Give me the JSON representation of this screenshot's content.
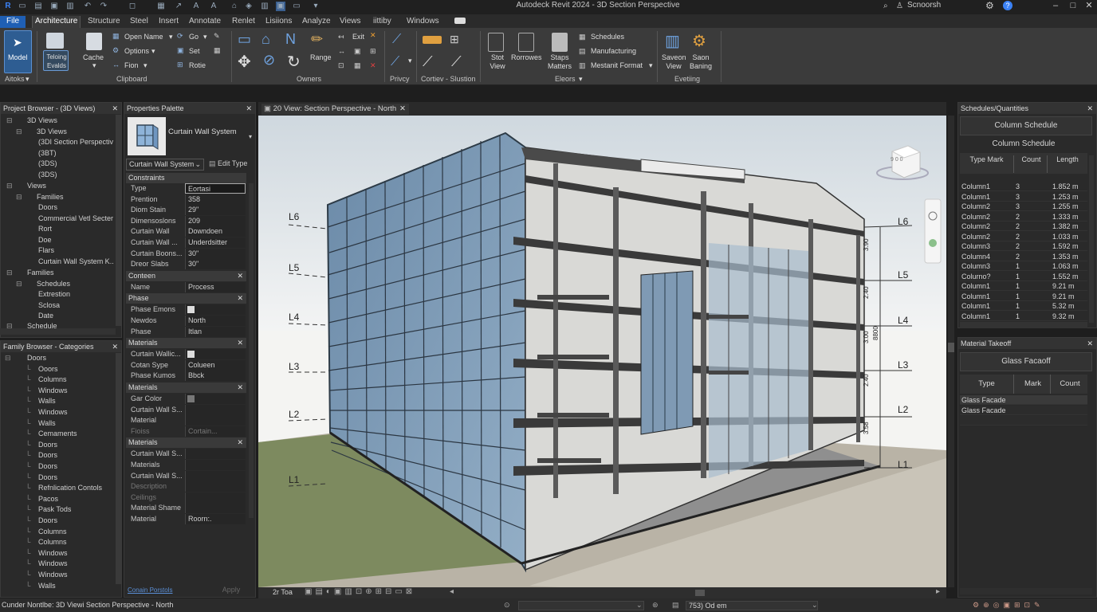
{
  "title_bar": {
    "title": "Autodeck Revit 2024 - 3D Section Perspective",
    "user": "Scnoorsh"
  },
  "tabs": [
    "File",
    "Architecture",
    "Structure",
    "Steel",
    "Insert",
    "Annotate",
    "Renlet",
    "Lisiions",
    "Analyze",
    "Views",
    "iittiby",
    "Windows"
  ],
  "ribbon": {
    "modify_label": "Model",
    "select_label": "Aitoks",
    "fielding_label": "Teloing Evalds",
    "cache_label": "Cache",
    "open_name": "Open Name",
    "options": "Options",
    "fion": "Fion",
    "go": "Go",
    "set": "Set",
    "rotie": "Rotie",
    "clipboard": "Clipboard",
    "exit": "Exit",
    "range": "Range",
    "owners": "Owners",
    "privcy": "Privcy",
    "cortiev_slustion": "Cortiev - Slustion",
    "stot_view": "Stot View",
    "rorrowes": "Rorrowes",
    "staps_matters": "Staps Matters",
    "schedules": "Schedules",
    "manufacturing": "Manufacturing",
    "mestanit_format": "Mestanit Format",
    "eleors": "Eleors",
    "saveon_view": "Saveon View",
    "saon_baning": "Saon Baning",
    "evetiing": "Evetiing"
  },
  "project_browser": {
    "title": "Project Browser - (3D Views)",
    "items": [
      "3D Views",
      "3D Views",
      "(3DI Section Perspectiv",
      "(3BT)",
      "(3DS)",
      "(3DS)",
      "Views",
      "Families",
      "Doors",
      "Commercial Vetl Secter",
      "Rort",
      "Doe",
      "Flars",
      "Curtain Wall System K..",
      "Families",
      "Schedules",
      "Extrestion",
      "Sclosa",
      "Date",
      "Schedule"
    ]
  },
  "family_browser": {
    "title": "Family Browser - Categories",
    "items": [
      "Doors",
      "Ooors",
      "Columns",
      "Windows",
      "Walls",
      "Windows",
      "Walls",
      "Cemaments",
      "Doors",
      "Doors",
      "Doors",
      "Doors",
      "Refnlication Contols",
      "Pacos",
      "Pask Tods",
      "Doors",
      "Columns",
      "Columns",
      "Windows",
      "Windows",
      "Windows",
      "Walls"
    ]
  },
  "properties": {
    "title": "Properties Palette",
    "type_name": "Curtain Wall System",
    "type_selector": "Curtain Wall System",
    "edit_type": "Edit Type",
    "sections": [
      {
        "name": "Constraints",
        "rows": [
          [
            "Type",
            "Eortasi"
          ],
          [
            "Prention",
            "358"
          ],
          [
            "Diom Stain",
            "29\""
          ],
          [
            "Dimensoslons",
            "209"
          ],
          [
            "Curtain Wall",
            "Downdoen"
          ],
          [
            "Curtain Wall ...",
            "Underdsitter"
          ],
          [
            "Curtain Boons...",
            "30\""
          ],
          [
            "Dreor Slabs",
            "30\""
          ]
        ]
      },
      {
        "name": "Conteen",
        "rows": [
          [
            "Name",
            "Process"
          ]
        ]
      },
      {
        "name": "Phase",
        "rows": [
          [
            "Phase Emons",
            ""
          ],
          [
            "Newdos",
            "North"
          ],
          [
            "Phase",
            "Itlan"
          ]
        ]
      },
      {
        "name": "Materials",
        "rows": [
          [
            "Curtain Wallic...",
            ""
          ],
          [
            "Cotan Sype",
            "Colueen"
          ],
          [
            "Phase Kumos",
            "Bbck"
          ]
        ]
      },
      {
        "name": "Materials",
        "rows": [
          [
            "Gar Color",
            ""
          ],
          [
            "Curtain Wall S...",
            ""
          ],
          [
            "Material",
            ""
          ],
          [
            "Fioiss",
            "Cortain..."
          ]
        ]
      },
      {
        "name": "Materials",
        "rows": [
          [
            "Curtain Wall S...",
            ""
          ],
          [
            "Materials",
            ""
          ],
          [
            "Curtain Wall S...",
            ""
          ],
          [
            "Description",
            ""
          ],
          [
            "Ceilings",
            ""
          ],
          [
            "Material Shame",
            ""
          ],
          [
            "Material",
            "Roorn:."
          ]
        ]
      }
    ],
    "help_link": "Conain Porstols",
    "apply": "Apply"
  },
  "view": {
    "tab_title": "20 View: Section Perspective - North",
    "levels_left": [
      "L6",
      "L5",
      "L4",
      "L3",
      "L2",
      "L1"
    ],
    "levels_right": [
      "L6",
      "L5",
      "L4",
      "L3",
      "L2",
      "L1"
    ],
    "dims": [
      "3.90",
      "2.40",
      "3.00",
      "8800",
      "2.40",
      "3.58"
    ],
    "viewcube_label": "9 0 0",
    "scale": "2r Toa"
  },
  "column_schedule": {
    "panel_title": "Schedules/Quantities",
    "header": "Column Schedule",
    "title": "Column Schedule",
    "columns": [
      "Type Mark",
      "Count",
      "Length"
    ],
    "rows": [
      [
        "Column1",
        "3",
        "1.852 m"
      ],
      [
        "Column1",
        "3",
        "1.253 m"
      ],
      [
        "Column2",
        "3",
        "1.255 m"
      ],
      [
        "Column2",
        "2",
        "1.333 m"
      ],
      [
        "Column2",
        "2",
        "1.382 m"
      ],
      [
        "Column2",
        "2",
        "1.033 m"
      ],
      [
        "Column3",
        "2",
        "1.592 m"
      ],
      [
        "Column4",
        "2",
        "1.353 m"
      ],
      [
        "Column3",
        "1",
        "1.063 m"
      ],
      [
        "Colurno?",
        "1",
        "1.552 m"
      ],
      [
        "Column1",
        "1",
        "9.21 m"
      ],
      [
        "Column1",
        "1",
        "9.21 m"
      ],
      [
        "Column1",
        "1",
        "5.32 m"
      ],
      [
        "Column1",
        "1",
        "9.32 m"
      ]
    ]
  },
  "material_takeoff": {
    "panel_title": "Material Takeoff",
    "header": "Glass Facaoff",
    "columns": [
      "Type",
      "Mark",
      "Count"
    ],
    "rows": [
      [
        "Glass Facade",
        "",
        ""
      ],
      [
        "Glass Facade",
        "",
        ""
      ],
      [
        "",
        "",
        ""
      ]
    ]
  },
  "status": {
    "text": "Cunder Nontlbe: 3D Viewi Section Perspective - North",
    "zoom": "753) Od em"
  }
}
